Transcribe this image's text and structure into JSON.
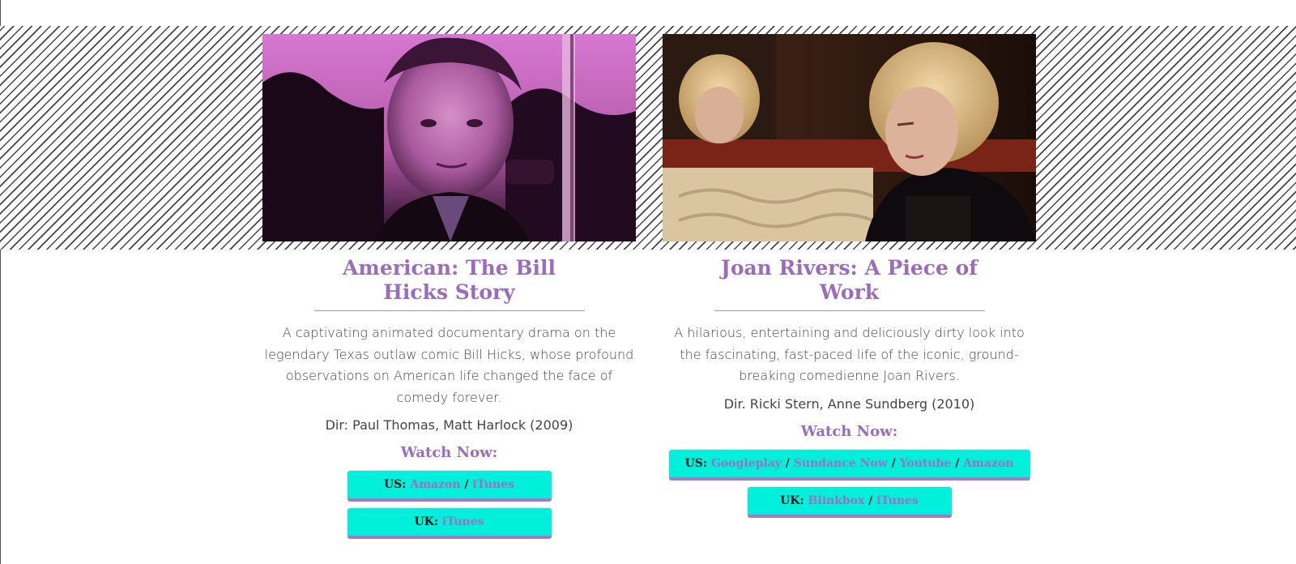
{
  "films": [
    {
      "title": "American: The Bill Hicks Story",
      "description": "A captivating animated documentary drama on the legendary Texas outlaw comic Bill Hicks, whose profound observations on American life changed the face of comedy forever.",
      "director": "Dir: Paul Thomas, Matt Harlock (2009)",
      "watch_heading": "Watch Now:",
      "us_label": "US:",
      "us_links": [
        "Amazon",
        "iTunes"
      ],
      "uk_label": "UK:",
      "uk_links": [
        "iTunes"
      ],
      "separator": "/"
    },
    {
      "title": "Joan Rivers: A Piece of Work",
      "description": "A hilarious, entertaining and deliciously dirty look into the fascinating, fast-paced life of the iconic, ground-breaking comedienne Joan Rivers.",
      "director": "Dir. Ricki Stern, Anne Sundberg (2010)",
      "watch_heading": "Watch Now:",
      "us_label": "US:",
      "us_links": [
        "Googleplay",
        "Sundance Now",
        "Youtube",
        "Amazon"
      ],
      "uk_label": "UK:",
      "uk_links": [
        "Blinkbox",
        "iTunes"
      ],
      "separator": "/"
    }
  ],
  "colors": {
    "accent_purple": "#9b6bbd",
    "button_cyan": "#00f0dc",
    "button_border": "#a878c6"
  }
}
